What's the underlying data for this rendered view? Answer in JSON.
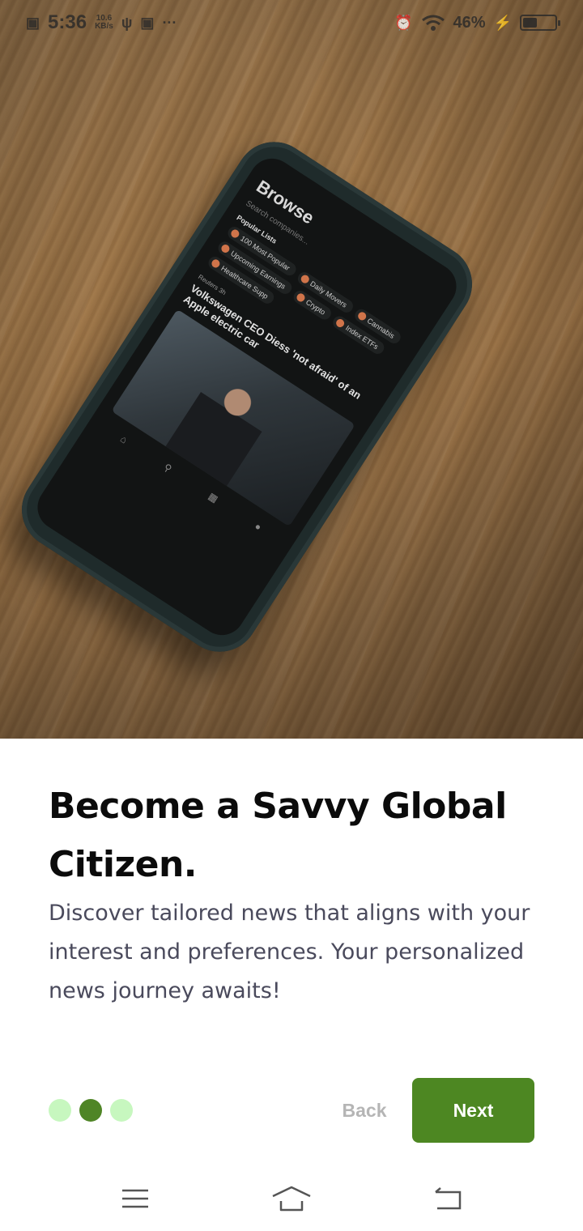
{
  "status_bar": {
    "time": "5:36",
    "net_speed_value": "10.6",
    "net_speed_unit": "KB/s",
    "more": "···",
    "battery_percent": "46%",
    "battery_level": 0.46
  },
  "hero_phone": {
    "screen_title": "Browse",
    "search_placeholder": "Search companies...",
    "section_title": "Popular Lists",
    "chips": [
      "100 Most Popular",
      "Daily Movers",
      "Cannabis",
      "Upcoming Earnings",
      "Crypto",
      "Index ETFs",
      "Healthcare Supp"
    ],
    "source": "Reuters 3h",
    "headline": "Volkswagen CEO Diess 'not afraid' of an Apple electric car"
  },
  "onboarding": {
    "title": "Become a Savvy Global Citizen.",
    "description": "Discover tailored news that aligns with your interest and preferences. Your personalized news journey awaits!",
    "page_indicator": {
      "total": 3,
      "current": 2
    },
    "back_label": "Back",
    "next_label": "Next"
  },
  "colors": {
    "primary": "#4d8722",
    "dot_inactive": "#c7f7bf",
    "dot_active": "#4f8526",
    "title": "#0b0b0b",
    "body_text": "#4a4a5c",
    "back_text": "#b5b5b5"
  },
  "navigation_bar": {
    "icons": [
      "menu-icon",
      "home-icon",
      "back-icon"
    ]
  }
}
